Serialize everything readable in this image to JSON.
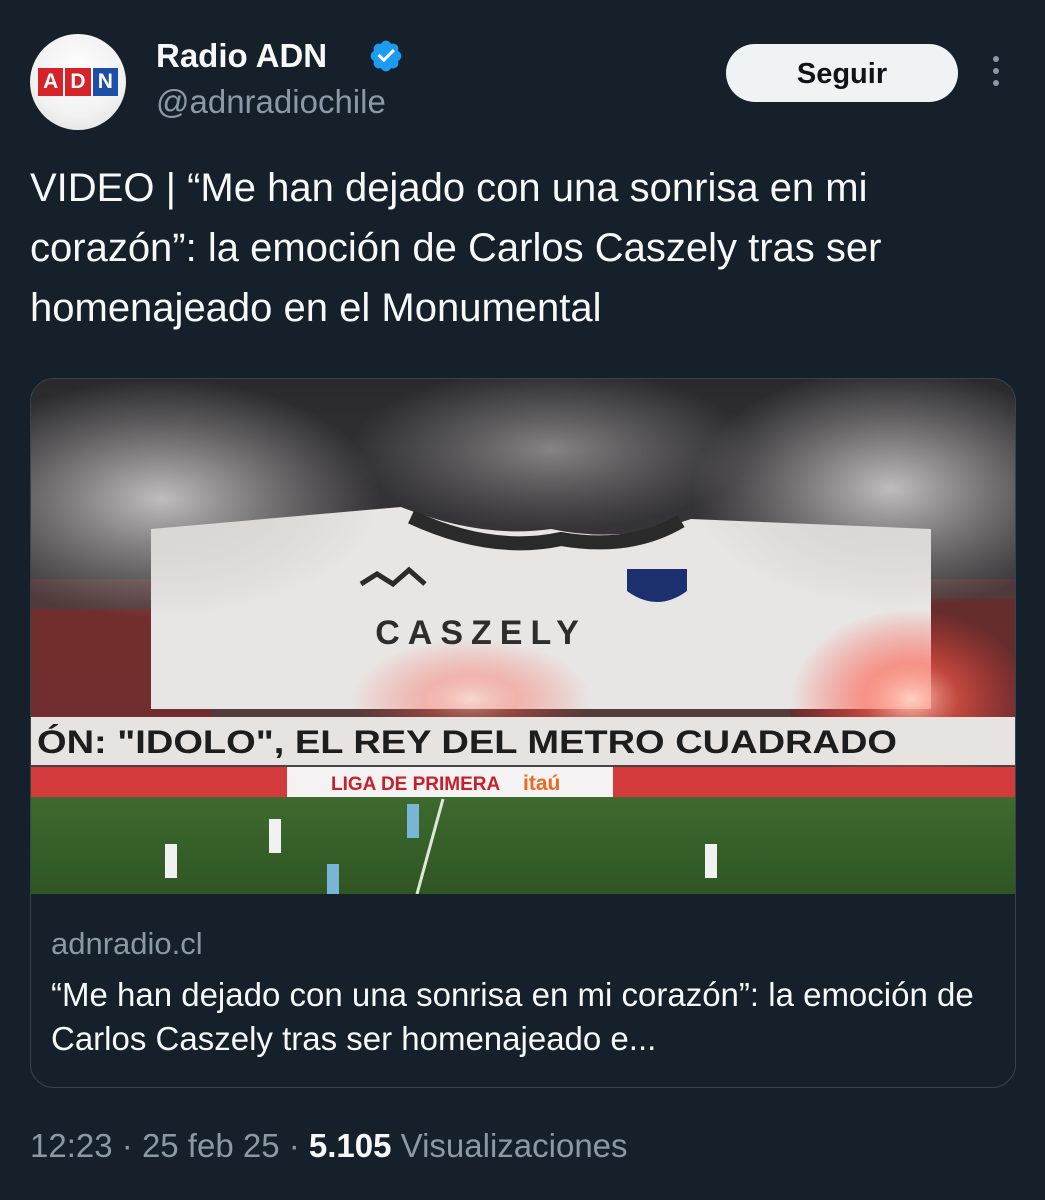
{
  "account": {
    "avatar_logo": [
      "A",
      "D",
      "N"
    ],
    "display_name": "Radio ADN",
    "handle": "@adnradiochile",
    "verified": true,
    "verified_color": "#1d9bf0"
  },
  "actions": {
    "follow_label": "Seguir",
    "more_icon": "more-vertical-icon"
  },
  "tweet": {
    "text": "VIDEO | “Me han dejado con una sonrisa en mi corazón”: la emoción de Carlos Caszely tras ser homenajeado en el Monumental"
  },
  "card": {
    "image_texts": {
      "jersey_name": "CASZELY",
      "banner": "ÓN: \"IDOLO\", EL REY DEL METRO CUADRADO",
      "ad_board": "LIGA DE PRIMERA",
      "ad_board_brand": "itaú"
    },
    "domain": "adnradio.cl",
    "title": "“Me han dejado con una sonrisa en mi corazón”: la emoción de Carlos Caszely tras ser homenajeado e..."
  },
  "meta": {
    "time": "12:23",
    "separator": "·",
    "date": "25 feb 25",
    "views_count": "5.105",
    "views_label": "Visualizaciones"
  },
  "colors": {
    "background": "#15202b",
    "text_primary": "#f7f9f9",
    "text_secondary": "#8b98a5",
    "follow_button_bg": "#eff3f4",
    "brand_red": "#d6232a",
    "brand_blue": "#1b4fa8"
  }
}
